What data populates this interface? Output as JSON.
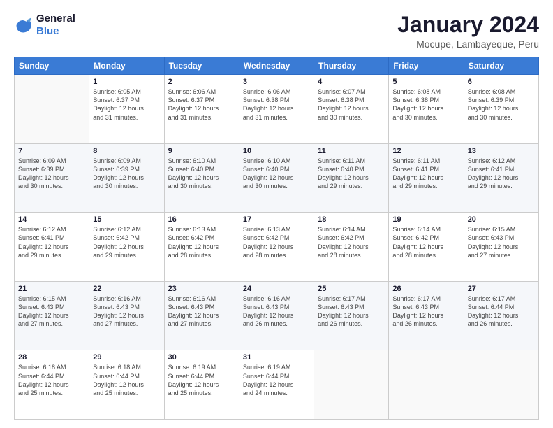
{
  "logo": {
    "line1": "General",
    "line2": "Blue"
  },
  "header": {
    "title": "January 2024",
    "subtitle": "Mocupe, Lambayeque, Peru"
  },
  "weekdays": [
    "Sunday",
    "Monday",
    "Tuesday",
    "Wednesday",
    "Thursday",
    "Friday",
    "Saturday"
  ],
  "weeks": [
    [
      {
        "num": "",
        "info": ""
      },
      {
        "num": "1",
        "info": "Sunrise: 6:05 AM\nSunset: 6:37 PM\nDaylight: 12 hours\nand 31 minutes."
      },
      {
        "num": "2",
        "info": "Sunrise: 6:06 AM\nSunset: 6:37 PM\nDaylight: 12 hours\nand 31 minutes."
      },
      {
        "num": "3",
        "info": "Sunrise: 6:06 AM\nSunset: 6:38 PM\nDaylight: 12 hours\nand 31 minutes."
      },
      {
        "num": "4",
        "info": "Sunrise: 6:07 AM\nSunset: 6:38 PM\nDaylight: 12 hours\nand 30 minutes."
      },
      {
        "num": "5",
        "info": "Sunrise: 6:08 AM\nSunset: 6:38 PM\nDaylight: 12 hours\nand 30 minutes."
      },
      {
        "num": "6",
        "info": "Sunrise: 6:08 AM\nSunset: 6:39 PM\nDaylight: 12 hours\nand 30 minutes."
      }
    ],
    [
      {
        "num": "7",
        "info": "Sunrise: 6:09 AM\nSunset: 6:39 PM\nDaylight: 12 hours\nand 30 minutes."
      },
      {
        "num": "8",
        "info": "Sunrise: 6:09 AM\nSunset: 6:39 PM\nDaylight: 12 hours\nand 30 minutes."
      },
      {
        "num": "9",
        "info": "Sunrise: 6:10 AM\nSunset: 6:40 PM\nDaylight: 12 hours\nand 30 minutes."
      },
      {
        "num": "10",
        "info": "Sunrise: 6:10 AM\nSunset: 6:40 PM\nDaylight: 12 hours\nand 30 minutes."
      },
      {
        "num": "11",
        "info": "Sunrise: 6:11 AM\nSunset: 6:40 PM\nDaylight: 12 hours\nand 29 minutes."
      },
      {
        "num": "12",
        "info": "Sunrise: 6:11 AM\nSunset: 6:41 PM\nDaylight: 12 hours\nand 29 minutes."
      },
      {
        "num": "13",
        "info": "Sunrise: 6:12 AM\nSunset: 6:41 PM\nDaylight: 12 hours\nand 29 minutes."
      }
    ],
    [
      {
        "num": "14",
        "info": "Sunrise: 6:12 AM\nSunset: 6:41 PM\nDaylight: 12 hours\nand 29 minutes."
      },
      {
        "num": "15",
        "info": "Sunrise: 6:12 AM\nSunset: 6:42 PM\nDaylight: 12 hours\nand 29 minutes."
      },
      {
        "num": "16",
        "info": "Sunrise: 6:13 AM\nSunset: 6:42 PM\nDaylight: 12 hours\nand 28 minutes."
      },
      {
        "num": "17",
        "info": "Sunrise: 6:13 AM\nSunset: 6:42 PM\nDaylight: 12 hours\nand 28 minutes."
      },
      {
        "num": "18",
        "info": "Sunrise: 6:14 AM\nSunset: 6:42 PM\nDaylight: 12 hours\nand 28 minutes."
      },
      {
        "num": "19",
        "info": "Sunrise: 6:14 AM\nSunset: 6:42 PM\nDaylight: 12 hours\nand 28 minutes."
      },
      {
        "num": "20",
        "info": "Sunrise: 6:15 AM\nSunset: 6:43 PM\nDaylight: 12 hours\nand 27 minutes."
      }
    ],
    [
      {
        "num": "21",
        "info": "Sunrise: 6:15 AM\nSunset: 6:43 PM\nDaylight: 12 hours\nand 27 minutes."
      },
      {
        "num": "22",
        "info": "Sunrise: 6:16 AM\nSunset: 6:43 PM\nDaylight: 12 hours\nand 27 minutes."
      },
      {
        "num": "23",
        "info": "Sunrise: 6:16 AM\nSunset: 6:43 PM\nDaylight: 12 hours\nand 27 minutes."
      },
      {
        "num": "24",
        "info": "Sunrise: 6:16 AM\nSunset: 6:43 PM\nDaylight: 12 hours\nand 26 minutes."
      },
      {
        "num": "25",
        "info": "Sunrise: 6:17 AM\nSunset: 6:43 PM\nDaylight: 12 hours\nand 26 minutes."
      },
      {
        "num": "26",
        "info": "Sunrise: 6:17 AM\nSunset: 6:43 PM\nDaylight: 12 hours\nand 26 minutes."
      },
      {
        "num": "27",
        "info": "Sunrise: 6:17 AM\nSunset: 6:44 PM\nDaylight: 12 hours\nand 26 minutes."
      }
    ],
    [
      {
        "num": "28",
        "info": "Sunrise: 6:18 AM\nSunset: 6:44 PM\nDaylight: 12 hours\nand 25 minutes."
      },
      {
        "num": "29",
        "info": "Sunrise: 6:18 AM\nSunset: 6:44 PM\nDaylight: 12 hours\nand 25 minutes."
      },
      {
        "num": "30",
        "info": "Sunrise: 6:19 AM\nSunset: 6:44 PM\nDaylight: 12 hours\nand 25 minutes."
      },
      {
        "num": "31",
        "info": "Sunrise: 6:19 AM\nSunset: 6:44 PM\nDaylight: 12 hours\nand 24 minutes."
      },
      {
        "num": "",
        "info": ""
      },
      {
        "num": "",
        "info": ""
      },
      {
        "num": "",
        "info": ""
      }
    ]
  ]
}
